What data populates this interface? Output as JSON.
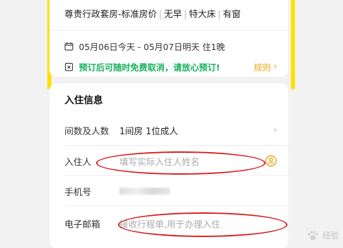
{
  "room": {
    "name": "尊贵行政套房-标准房价",
    "tags": [
      "无早",
      "特大床",
      "有窗"
    ]
  },
  "stay": {
    "dates": "05月06日今天 - 05月07日明天 住1晚"
  },
  "policy": {
    "text": "预订后可随时免费取消，请放心预订!",
    "rules_label": "规则",
    "color": "#17b05b",
    "rules_color": "#e8a417"
  },
  "checkin": {
    "title": "入住信息",
    "rooms_label": "间数及人数",
    "rooms_value": "1间房 1位成人",
    "guest_label": "入住人",
    "guest_placeholder": "填写实际入住人姓名",
    "phone_label": "手机号",
    "email_label": "电子邮箱",
    "email_placeholder": "接收行程单,用于办理入住"
  },
  "watermark": {
    "text": "经验"
  },
  "colors": {
    "accent_yellow": "#ffe000",
    "annotation_red": "#d81e1e"
  },
  "icons": [
    "calendar-icon",
    "cancel-policy-icon",
    "chevron-right-icon",
    "contact-book-icon",
    "paw-logo-icon"
  ]
}
